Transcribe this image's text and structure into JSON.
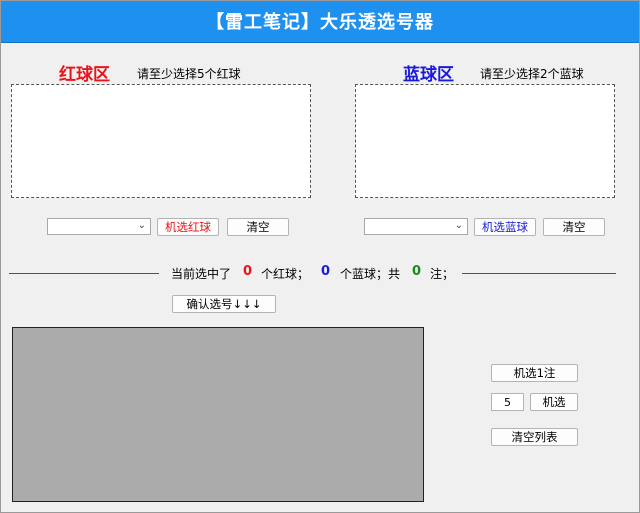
{
  "window": {
    "title": "【雷工笔记】大乐透选号器"
  },
  "red_zone": {
    "title": "红球区",
    "hint": "请至少选择5个红球",
    "random_button": "机选红球",
    "clear_button": "清空",
    "title_color": "#e8141b"
  },
  "blue_zone": {
    "title": "蓝球区",
    "hint": "请至少选择2个蓝球",
    "random_button": "机选蓝球",
    "clear_button": "清空",
    "title_color": "#1a1ad8"
  },
  "status": {
    "prefix": "当前选中了",
    "red_count": "0",
    "red_label": "个红球；",
    "blue_count": "0",
    "blue_label": "个蓝球；共",
    "total_count": "0",
    "total_label": "注；",
    "red_color": "#e8141b",
    "blue_color": "#1a1ad8",
    "total_color": "#1a8a1a"
  },
  "confirm_button": "确认选号↓↓↓",
  "side_panel": {
    "random_one": "机选1注",
    "count_value": "5",
    "random_n": "机选",
    "clear_list": "清空列表"
  }
}
